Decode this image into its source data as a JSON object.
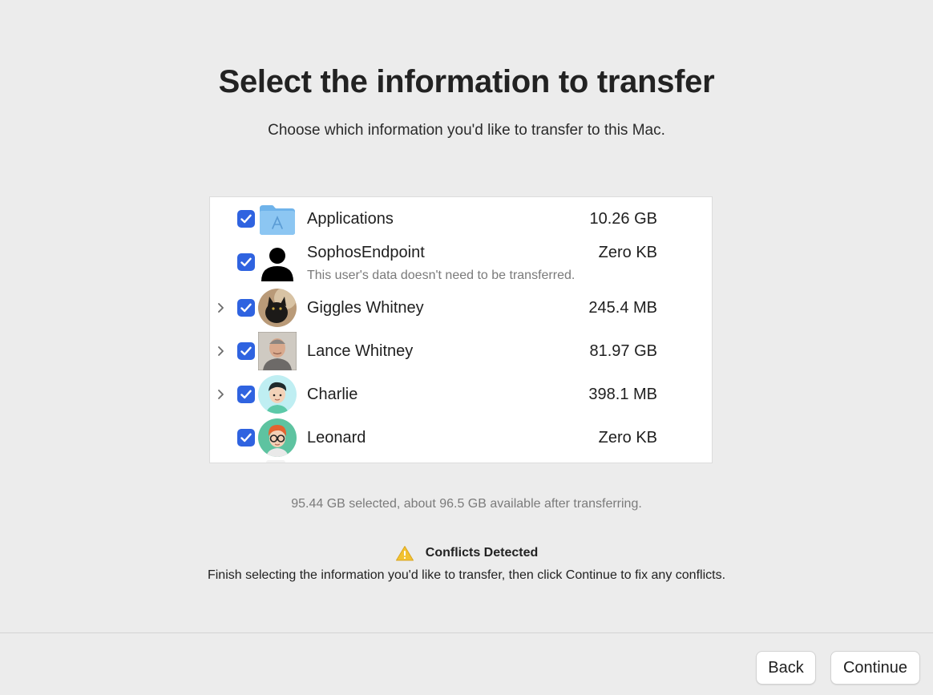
{
  "header": {
    "title": "Select the information to transfer",
    "subtitle": "Choose which information you'd like to transfer to this Mac."
  },
  "items": [
    {
      "name": "Applications",
      "size": "10.26 GB",
      "checked": true,
      "expandable": false,
      "icon": "applications-folder-icon"
    },
    {
      "name": "SophosEndpoint",
      "size": "Zero KB",
      "note": "This user's data doesn't need to be transferred.",
      "checked": true,
      "expandable": false,
      "icon": "user-silhouette-icon"
    },
    {
      "name": "Giggles Whitney",
      "size": "245.4 MB",
      "checked": true,
      "expandable": true,
      "icon": "cat-photo-avatar"
    },
    {
      "name": "Lance Whitney",
      "size": "81.97 GB",
      "checked": true,
      "expandable": true,
      "icon": "man-photo-avatar"
    },
    {
      "name": "Charlie",
      "size": "398.1 MB",
      "checked": true,
      "expandable": true,
      "icon": "memoji-avatar"
    },
    {
      "name": "Leonard",
      "size": "Zero KB",
      "checked": true,
      "expandable": false,
      "icon": "memoji-glasses-avatar"
    }
  ],
  "summary": "95.44 GB selected, about 96.5 GB available after transferring.",
  "conflicts": {
    "title": "Conflicts Detected",
    "message": "Finish selecting the information you'd like to transfer, then click Continue to fix any conflicts."
  },
  "buttons": {
    "back": "Back",
    "continue": "Continue"
  },
  "colors": {
    "accent": "#2f63e0",
    "warning": "#f2c230"
  }
}
